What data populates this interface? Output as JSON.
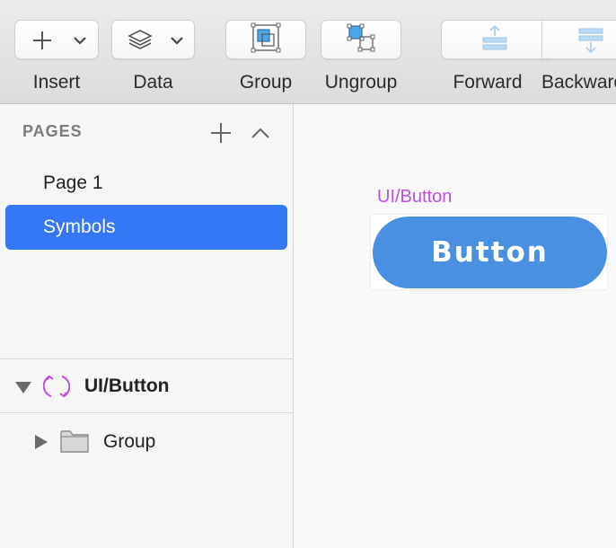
{
  "toolbar": {
    "insert": {
      "label": "Insert",
      "icon": "plus-icon"
    },
    "data": {
      "label": "Data",
      "icon": "layers-icon"
    },
    "group": {
      "label": "Group",
      "icon": "group-icon"
    },
    "ungroup": {
      "label": "Ungroup",
      "icon": "ungroup-icon"
    },
    "forward": {
      "label": "Forward",
      "icon": "bring-forward-icon"
    },
    "backward": {
      "label": "Backward",
      "icon": "send-backward-icon"
    }
  },
  "pages": {
    "header": "PAGES",
    "items": [
      {
        "label": "Page 1",
        "selected": false
      },
      {
        "label": "Symbols",
        "selected": true
      }
    ]
  },
  "layers": {
    "symbol": {
      "label": "UI/Button",
      "icon": "symbol-icon"
    },
    "group": {
      "label": "Group",
      "icon": "folder-icon"
    }
  },
  "canvas": {
    "artboard_title": "UI/Button",
    "button_label": "Button"
  },
  "colors": {
    "accent": "#3478f6",
    "symbol": "#c04de0",
    "button_fill": "#4a90e2",
    "icon_blue": "#4aa8e8"
  }
}
